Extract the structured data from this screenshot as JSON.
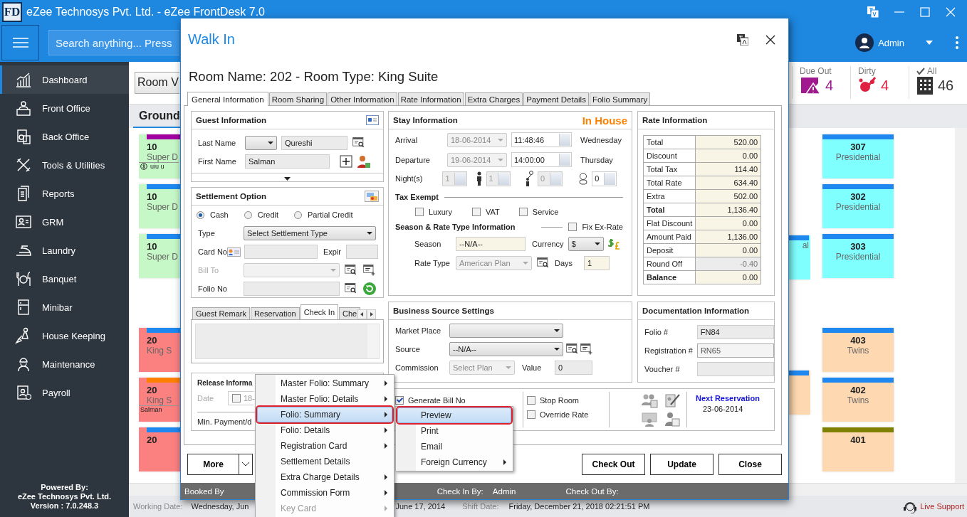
{
  "window": {
    "logo": "FD",
    "title": "eZee Technosys Pvt. Ltd. - eZee FrontDesk 7.0"
  },
  "header": {
    "search_placeholder": "Search anything... Press",
    "user": "Admin"
  },
  "sidebar": {
    "items": [
      {
        "label": "Dashboard",
        "selected": true
      },
      {
        "label": "Front Office",
        "selected": false
      },
      {
        "label": "Back Office",
        "selected": false
      },
      {
        "label": "Tools & Utilities",
        "selected": false
      },
      {
        "label": "Reports",
        "selected": false
      },
      {
        "label": "GRM",
        "selected": false
      },
      {
        "label": "Laundry",
        "selected": false
      },
      {
        "label": "Banquet",
        "selected": false
      },
      {
        "label": "Minibar",
        "selected": false
      },
      {
        "label": "House Keeping",
        "selected": false
      },
      {
        "label": "Maintenance",
        "selected": false
      },
      {
        "label": "Payroll",
        "selected": false
      }
    ],
    "footer": [
      "Powered By:",
      "eZee Technosys Pvt. Ltd.",
      "Version : 7.0.248.3"
    ]
  },
  "main": {
    "view_select": "Room V",
    "stats": [
      {
        "kind": "due_out",
        "label": "Due Out",
        "count": "4"
      },
      {
        "kind": "dirty",
        "label": "Dirty",
        "count": "4"
      },
      {
        "kind": "all",
        "label": "All",
        "count": "46"
      }
    ],
    "floor_tab": "Ground",
    "columns": [
      {
        "groups": [
          [
            {
              "number": "10",
              "type": "Super D",
              "guest": "uiu u",
              "color": "#c6f7c6",
              "stripe": {
                "color": "#a000a0"
              },
              "deposit": true
            },
            {
              "number": "10",
              "type": "Super D",
              "color": "#c6f7c6",
              "stripe": {
                "color": "#1e88f0"
              }
            },
            {
              "number": "10",
              "type": "Super D",
              "color": "#c6f7c6",
              "stripe": {
                "color": "#1e88f0"
              }
            }
          ],
          [
            {
              "number": "20",
              "type": "King S",
              "color": "#fb8080",
              "stripe": {
                "color": "#1e88f0"
              }
            },
            {
              "number": "20",
              "type": "King S",
              "guest": "Salman",
              "color": "#fb8080",
              "stripe": {
                "color": "#ff8000"
              }
            },
            {
              "number": "20",
              "color": "#fb8080",
              "stripe": {
                "color": "#1e88f0"
              }
            }
          ]
        ]
      },
      {
        "groups": [
          [
            {
              "type": "al",
              "color": "#80ffff",
              "stripe": {
                "color": "#1e88f0"
              }
            }
          ],
          [
            {
              "color": "#fdd8b0",
              "stripe": {
                "color": "#1e88f0"
              }
            }
          ]
        ]
      },
      {
        "groups": [
          [
            {
              "number": "307",
              "type": "Presidential",
              "color": "#80ffff",
              "stripe": {
                "color": "#1e88f0"
              }
            },
            {
              "number": "302",
              "type": "Presidential",
              "color": "#80ffff",
              "stripe": {
                "color": "#1e88f0"
              }
            },
            {
              "number": "303",
              "type": "Presidential",
              "color": "#80ffff",
              "stripe": {
                "color": "#1e88f0"
              }
            }
          ],
          [
            {
              "number": "403",
              "type": "Twins",
              "color": "#fdd8b0",
              "stripe": {
                "color": "#1e88f0"
              }
            },
            {
              "number": "402",
              "type": "Twins",
              "color": "#fdd8b0",
              "stripe": {
                "color": "#1e88f0"
              }
            },
            {
              "number": "401",
              "color": "#fdd8b0",
              "stripe": {
                "color": "#808000"
              }
            }
          ]
        ]
      }
    ]
  },
  "status_bar": {
    "working_date_label": "Working Date:",
    "working_date": "Wednesday, Jun",
    "date_tail": "June 17, 2014",
    "shift_date_label": "Shift Date:",
    "shift_date": "Friday, December 21, 2018 02:21:51 PM",
    "support": "Live Support"
  },
  "dialog": {
    "title": "Walk In",
    "heading": "Room Name: 202 - Room Type: King Suite",
    "tabs": [
      {
        "label": "General Information",
        "selected": true
      },
      {
        "label": "Room Sharing",
        "selected": false
      },
      {
        "label": "Other Information",
        "selected": false
      },
      {
        "label": "Rate Information",
        "selected": false
      },
      {
        "label": "Extra Charges",
        "selected": false
      },
      {
        "label": "Payment Details",
        "selected": false
      },
      {
        "label": "Folio Summary",
        "selected": false
      }
    ],
    "guest": {
      "title": "Guest Information",
      "last_name_label": "Last Name",
      "last_name": "Qureshi",
      "first_name_label": "First Name",
      "first_name": "Salman"
    },
    "settlement": {
      "title": "Settlement Option",
      "options": [
        {
          "label": "Cash",
          "selected": true
        },
        {
          "label": "Credit",
          "selected": false
        },
        {
          "label": "Partial Credit",
          "selected": false
        }
      ],
      "type_label": "Type",
      "type_value": "Select Settlement Type",
      "card_label": "Card No",
      "expiry_label": "Expir",
      "bill_to_label": "Bill To",
      "bill_to_disabled": true,
      "folio_label": "Folio No"
    },
    "remarks": {
      "tabs": [
        {
          "label": "Guest Remark",
          "selected": false
        },
        {
          "label": "Reservation",
          "selected": false
        },
        {
          "label": "Check In",
          "selected": true
        },
        {
          "label": "Che",
          "selected": false
        }
      ]
    },
    "release": {
      "title": "Release Informa",
      "date_label": "Date",
      "date_checked": false,
      "date": "18-",
      "min_payment_label": "Min. Payment/d"
    },
    "stay": {
      "title": "Stay Information",
      "status": "In House",
      "rows": [
        {
          "label": "Arrival",
          "date": "18-06-2014",
          "time": "11:48:46",
          "day": "Wednesday"
        },
        {
          "label": "Departure",
          "date": "19-06-2014",
          "time": "14:00:00",
          "day": "Thursday"
        }
      ],
      "counts_label": "Night(s)",
      "counts": [
        {
          "kind": "nights",
          "value": "1",
          "disabled": true
        },
        {
          "kind": "adults",
          "value": "1",
          "disabled": true
        },
        {
          "kind": "children",
          "value": "0",
          "disabled": true
        },
        {
          "kind": "infants",
          "value": "0",
          "disabled": false
        }
      ],
      "tax_title": "Tax Exempt",
      "tax_options": [
        {
          "label": "Luxury",
          "checked": false
        },
        {
          "label": "VAT",
          "checked": false
        },
        {
          "label": "Service",
          "checked": false
        }
      ],
      "season_title": "Season & Rate Type Information",
      "fix_rate": {
        "label": "Fix Ex-Rate",
        "checked": false
      },
      "season_label": "Season",
      "season": "--N/A--",
      "currency_label": "Currency",
      "currency": "$",
      "rate_type_label": "Rate Type",
      "rate_type": "American Plan",
      "days_label": "Days",
      "days": "1"
    },
    "rate": {
      "title": "Rate Information",
      "rows": [
        {
          "label": "Total",
          "value": "520.00",
          "bold": false,
          "disabled": false
        },
        {
          "label": "Discount",
          "value": "0.00",
          "bold": false,
          "disabled": false
        },
        {
          "label": "Total Tax",
          "value": "114.40",
          "bold": false,
          "disabled": false
        },
        {
          "label": "Total Rate",
          "value": "634.40",
          "bold": false,
          "disabled": false
        },
        {
          "label": "Extra",
          "value": "502.00",
          "bold": false,
          "disabled": false
        },
        {
          "label": "Total",
          "value": "1,136.40",
          "bold": true,
          "disabled": false
        },
        {
          "label": "Flat Discount",
          "value": "0.00",
          "bold": false,
          "disabled": false
        },
        {
          "label": "Amount Paid",
          "value": "1,136.00",
          "bold": false,
          "disabled": false
        },
        {
          "label": "Deposit",
          "value": "0.00",
          "bold": false,
          "disabled": false
        },
        {
          "label": "Round Off",
          "value": "-0.40",
          "bold": false,
          "disabled": true
        },
        {
          "label": "Balance",
          "value": "0.00",
          "bold": true,
          "disabled": false
        }
      ]
    },
    "business": {
      "title": "Business Source Settings",
      "market_label": "Market Place",
      "source_label": "Source",
      "source": "--N/A--",
      "commission_label": "Commission",
      "commission": "Select Plan",
      "value_label": "Value",
      "value": "0"
    },
    "docs": {
      "title": "Documentation Information",
      "rows": [
        {
          "label": "Folio #",
          "value": "FN84",
          "disabled": false
        },
        {
          "label": "Registration #",
          "value": "RN65",
          "disabled": true
        },
        {
          "label": "Voucher #",
          "disabled": false
        }
      ]
    },
    "options": {
      "checks": [
        {
          "label": "Generate Bill No",
          "checked": true
        },
        {
          "label": "Stop Room",
          "checked": false
        },
        {
          "label": "Override Rate",
          "checked": false
        }
      ],
      "next_title": "Next Reservation",
      "next_date": "23-06-2014"
    },
    "more_button": "More",
    "actions": [
      "Check Out",
      "Update",
      "Close"
    ],
    "footer": {
      "booked_by": "Booked By",
      "check_in_label": "Check In By:",
      "check_in": "Admin",
      "check_out_label": "Check Out By:"
    }
  },
  "context_menu": {
    "items": [
      {
        "label": "Master Folio: Summary",
        "submenu": true,
        "selected": false,
        "disabled": false
      },
      {
        "label": "Master Folio: Details",
        "submenu": true,
        "selected": false,
        "disabled": false
      },
      {
        "label": "Folio: Summary",
        "submenu": true,
        "selected": true,
        "disabled": false
      },
      {
        "label": "Folio: Details",
        "submenu": true,
        "selected": false,
        "disabled": false
      },
      {
        "label": "Registration Card",
        "submenu": true,
        "selected": false,
        "disabled": false
      },
      {
        "label": "Settlement Details",
        "submenu": false,
        "selected": false,
        "disabled": false
      },
      {
        "label": "Extra Charge Details",
        "submenu": true,
        "selected": false,
        "disabled": false
      },
      {
        "label": "Commission Form",
        "submenu": true,
        "selected": false,
        "disabled": false
      },
      {
        "label": "Key Card",
        "submenu": true,
        "selected": false,
        "disabled": true
      }
    ]
  },
  "submenu": {
    "items": [
      {
        "label": "Preview",
        "submenu": false,
        "selected": true,
        "disabled": false
      },
      {
        "label": "Print",
        "submenu": false,
        "selected": false,
        "disabled": false
      },
      {
        "label": "Email",
        "submenu": false,
        "selected": false,
        "disabled": false
      },
      {
        "label": "Foreign Currency",
        "submenu": true,
        "selected": false,
        "disabled": false
      }
    ]
  }
}
